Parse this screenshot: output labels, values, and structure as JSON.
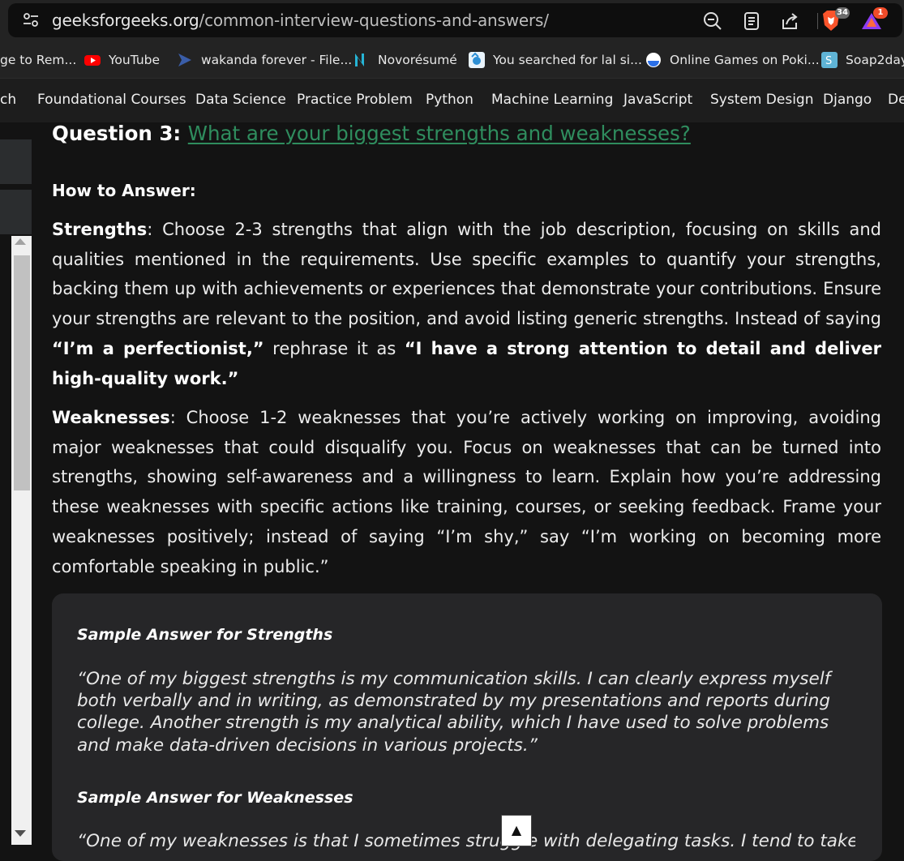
{
  "browser": {
    "url_host": "geeksforgeeks.org",
    "url_path": "/common-interview-questions-and-answers/",
    "brave_badge": "34",
    "rewards_badge": "1",
    "icons": [
      "site-settings-icon",
      "zoom-icon",
      "reader-mode-icon",
      "share-icon",
      "brave-shields-icon",
      "brave-rewards-icon"
    ]
  },
  "bookmarks": [
    {
      "label": "ge to Rem...",
      "icon": "bookmark-page-icon"
    },
    {
      "label": "YouTube",
      "icon": "youtube-icon"
    },
    {
      "label": "wakanda forever - File...",
      "icon": "filehost-icon"
    },
    {
      "label": "Novorésumé",
      "icon": "novoresume-icon"
    },
    {
      "label": "You searched for lal si...",
      "icon": "search-site-icon"
    },
    {
      "label": "Online Games on Poki...",
      "icon": "poki-icon"
    },
    {
      "label": "Soap2day",
      "icon": "soap2day-icon"
    }
  ],
  "nav": [
    "ch",
    "Foundational Courses",
    "Data Science",
    "Practice Problem",
    "Python",
    "Machine Learning",
    "JavaScript",
    "System Design",
    "Django",
    "De"
  ],
  "article": {
    "q_prefix": "Question 3:",
    "q_link": "What are your biggest strengths and weaknesses?",
    "how": "How to Answer:",
    "strengths_label": "Strengths",
    "strengths_text": ": Choose 2-3 strengths that align with the job description, focusing on skills and qualities mentioned in the requirements. Use specific examples to quantify your strengths, backing them up with achievements or experiences that demonstrate your contributions. Ensure your strengths are relevant to the position, and avoid listing generic strengths. Instead of saying ",
    "strengths_quote1": "“I’m a perfectionist,”",
    "strengths_mid": " rephrase it as ",
    "strengths_quote2": "“I have a strong attention to detail and deliver high-quality work.”",
    "weaknesses_label": "Weaknesses",
    "weaknesses_text": ": Choose 1-2 weaknesses that you’re actively working on improving, avoiding major weaknesses that could disqualify you. Focus on weaknesses that can be turned into strengths, showing self-awareness and a willingness to learn. Explain how you’re addressing these weaknesses with specific actions like training, courses, or seeking feedback. Frame your weaknesses positively; instead of saying “I’m shy,” say “I’m working on becoming more comfortable speaking in public.”",
    "sample_strengths_title": "Sample Answer for Strengths",
    "sample_strengths_text": "“One of my biggest strengths is my communication skills. I can clearly express myself both verbally and in writing, as demonstrated by my presentations and reports during college. Another strength is my analytical ability, which I have used to solve problems and make data-driven decisions in various projects.”",
    "sample_weaknesses_title": "Sample Answer for Weaknesses",
    "sample_weaknesses_text": "“One of my weaknesses is that I sometimes struggle with delegating tasks. I tend to take on",
    "back_to_top": "▲"
  },
  "colors": {
    "link": "#2f8d5e",
    "background": "#131313",
    "card": "#262628"
  }
}
